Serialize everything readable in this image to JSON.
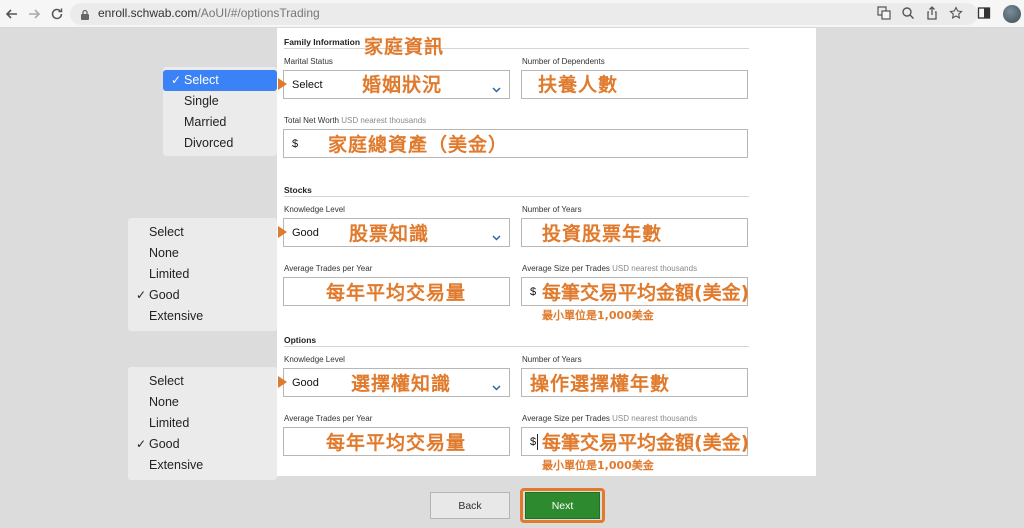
{
  "browser": {
    "url_host": "enroll.schwab.com",
    "url_path": "/AoUI/#/optionsTrading"
  },
  "family": {
    "title": "Family Information",
    "title_annotation": "家庭資訊",
    "marital_label": "Marital Status",
    "marital_value": "Select",
    "marital_annotation": "婚姻狀況",
    "dependents_label": "Number of Dependents",
    "dependents_annotation": "扶養人數",
    "networth_label": "Total Net Worth",
    "networth_hint": "USD nearest thousands",
    "networth_prefix": "$",
    "networth_annotation": "家庭總資產（美金）",
    "marital_options": [
      {
        "label": "Select",
        "checked": true
      },
      {
        "label": "Single",
        "checked": false
      },
      {
        "label": "Married",
        "checked": false
      },
      {
        "label": "Divorced",
        "checked": false
      }
    ]
  },
  "stocks": {
    "title": "Stocks",
    "knowledge_label": "Knowledge Level",
    "knowledge_value": "Good",
    "knowledge_annotation": "股票知識",
    "years_label": "Number of Years",
    "years_annotation": "投資股票年數",
    "trades_label": "Average Trades per Year",
    "trades_annotation": "每年平均交易量",
    "size_label": "Average Size per Trades",
    "size_hint": "USD nearest thousands",
    "size_prefix": "$",
    "size_annotation": "每筆交易平均金額(美金)",
    "size_note": "最小單位是1,000美金",
    "knowledge_options": [
      {
        "label": "Select",
        "checked": false
      },
      {
        "label": "None",
        "checked": false
      },
      {
        "label": "Limited",
        "checked": false
      },
      {
        "label": "Good",
        "checked": true
      },
      {
        "label": "Extensive",
        "checked": false
      }
    ]
  },
  "options": {
    "title": "Options",
    "knowledge_label": "Knowledge Level",
    "knowledge_value": "Good",
    "knowledge_annotation": "選擇權知識",
    "years_label": "Number of Years",
    "years_annotation": "操作選擇權年數",
    "trades_label": "Average Trades per Year",
    "trades_annotation": "每年平均交易量",
    "size_label": "Average Size per Trades",
    "size_hint": "USD nearest thousands",
    "size_prefix": "$",
    "size_annotation": "每筆交易平均金額(美金)",
    "size_note": "最小單位是1,000美金",
    "knowledge_options": [
      {
        "label": "Select",
        "checked": false
      },
      {
        "label": "None",
        "checked": false
      },
      {
        "label": "Limited",
        "checked": false
      },
      {
        "label": "Good",
        "checked": true
      },
      {
        "label": "Extensive",
        "checked": false
      }
    ]
  },
  "buttons": {
    "back": "Back",
    "next": "Next"
  },
  "colors": {
    "annotation": "#e07b2e",
    "next_button": "#2e8a2e",
    "highlight": "#3b82f6"
  }
}
